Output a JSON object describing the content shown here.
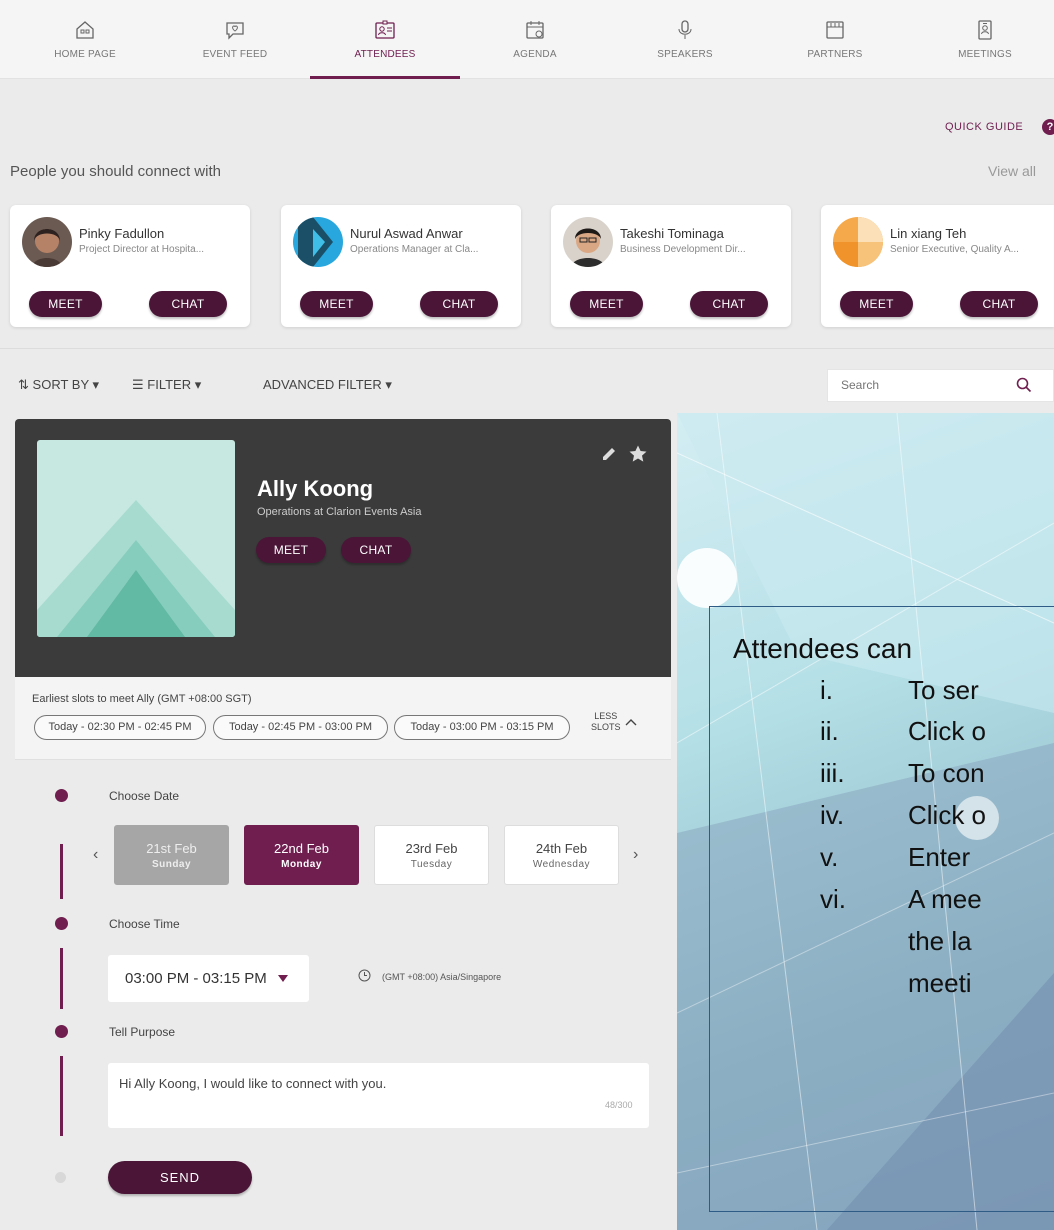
{
  "nav": [
    {
      "label": "HOME PAGE",
      "icon": "home-icon"
    },
    {
      "label": "EVENT FEED",
      "icon": "chat-bubble-icon"
    },
    {
      "label": "ATTENDEES",
      "icon": "id-card-icon",
      "active": true
    },
    {
      "label": "AGENDA",
      "icon": "calendar-icon"
    },
    {
      "label": "SPEAKERS",
      "icon": "microphone-icon"
    },
    {
      "label": "PARTNERS",
      "icon": "booth-icon"
    },
    {
      "label": "MEETINGS",
      "icon": "badge-icon"
    }
  ],
  "quick_guide": {
    "label": "QUICK GUIDE",
    "icon_text": "?"
  },
  "suggestions": {
    "title": "People you should connect with",
    "view_all": "View all",
    "people": [
      {
        "name": "Pinky Fadullon",
        "title": "Project Director at Hospita...",
        "meet": "MEET",
        "chat": "CHAT"
      },
      {
        "name": "Nurul Aswad Anwar",
        "title": "Operations Manager at Cla...",
        "meet": "MEET",
        "chat": "CHAT"
      },
      {
        "name": "Takeshi Tominaga",
        "title": "Business Development Dir...",
        "meet": "MEET",
        "chat": "CHAT"
      },
      {
        "name": "Lin xiang Teh",
        "title": "Senior Executive, Quality A...",
        "meet": "MEET",
        "chat": "CHAT"
      }
    ]
  },
  "toolbar": {
    "sort": "SORT BY",
    "filter": "FILTER",
    "advanced": "ADVANCED FILTER",
    "search_placeholder": "Search"
  },
  "profile": {
    "name": "Ally Koong",
    "title": "Operations at Clarion Events Asia",
    "meet": "MEET",
    "chat": "CHAT"
  },
  "slots": {
    "label": "Earliest slots to meet Ally (GMT +08:00 SGT)",
    "items": [
      "Today - 02:30 PM - 02:45 PM",
      "Today - 02:45 PM - 03:00 PM",
      "Today - 03:00 PM - 03:15 PM"
    ],
    "less_line1": "LESS",
    "less_line2": "SLOTS"
  },
  "form": {
    "step_date": "Choose Date",
    "step_time": "Choose Time",
    "step_purpose": "Tell Purpose",
    "dates": [
      {
        "date": "21st Feb",
        "day": "Sunday",
        "state": "past"
      },
      {
        "date": "22nd Feb",
        "day": "Monday",
        "state": "selected"
      },
      {
        "date": "23rd Feb",
        "day": "Tuesday",
        "state": "normal"
      },
      {
        "date": "24th Feb",
        "day": "Wednesday",
        "state": "normal"
      }
    ],
    "time_value": "03:00 PM - 03:15 PM",
    "timezone": "(GMT +08:00) Asia/Singapore",
    "purpose_text": "Hi Ally Koong, I would like to connect with you.",
    "purpose_count": "48/300",
    "send": "SEND"
  },
  "slide": {
    "heading": "Attendees can",
    "items": [
      {
        "num": "i.",
        "text": "To ser"
      },
      {
        "num": "ii.",
        "text": "Click o"
      },
      {
        "num": "iii.",
        "text": "To con"
      },
      {
        "num": "iv.",
        "text": "Click o"
      },
      {
        "num": "v.",
        "text": "Enter"
      },
      {
        "num": "vi.",
        "text": "A mee"
      },
      {
        "num": "",
        "text": "the la"
      },
      {
        "num": "",
        "text": "meeti"
      }
    ]
  },
  "colors": {
    "brand": "#6f1e4f",
    "brand_dark": "#4a1537",
    "header_dark": "#3b3b3b"
  }
}
